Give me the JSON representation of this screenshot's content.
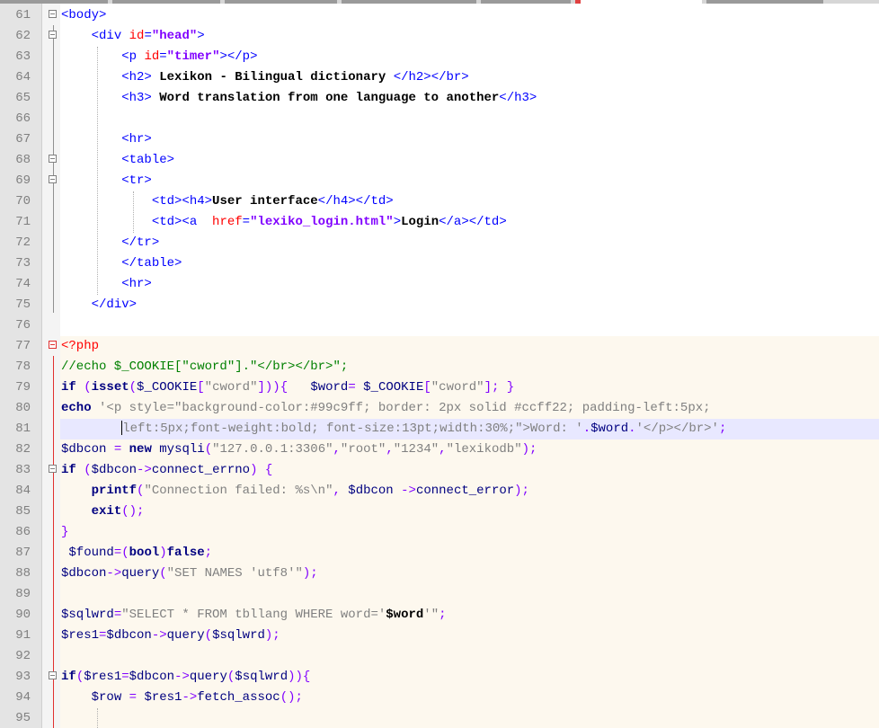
{
  "editor": {
    "lines": [
      {
        "num": "61",
        "segs": [
          {
            "c": "tag",
            "t": "<body>"
          }
        ]
      },
      {
        "num": "62",
        "segs": [
          {
            "c": "",
            "t": "    "
          },
          {
            "c": "tag",
            "t": "<div "
          },
          {
            "c": "attr",
            "t": "id"
          },
          {
            "c": "tag",
            "t": "="
          },
          {
            "c": "str",
            "t": "\"head\""
          },
          {
            "c": "tag",
            "t": ">"
          }
        ]
      },
      {
        "num": "63",
        "segs": [
          {
            "c": "",
            "t": "        "
          },
          {
            "c": "tag",
            "t": "<p "
          },
          {
            "c": "attr",
            "t": "id"
          },
          {
            "c": "tag",
            "t": "="
          },
          {
            "c": "str",
            "t": "\"timer\""
          },
          {
            "c": "tag",
            "t": "></p>"
          }
        ]
      },
      {
        "num": "64",
        "segs": [
          {
            "c": "",
            "t": "        "
          },
          {
            "c": "tag",
            "t": "<h2> "
          },
          {
            "c": "b",
            "t": "Lexikon - Bilingual dictionary "
          },
          {
            "c": "tag",
            "t": "</h2></br>"
          }
        ]
      },
      {
        "num": "65",
        "segs": [
          {
            "c": "",
            "t": "        "
          },
          {
            "c": "tag",
            "t": "<h3> "
          },
          {
            "c": "b",
            "t": "Word translation from one language to another"
          },
          {
            "c": "tag",
            "t": "</h3>"
          }
        ]
      },
      {
        "num": "66",
        "segs": []
      },
      {
        "num": "67",
        "segs": [
          {
            "c": "",
            "t": "        "
          },
          {
            "c": "tag",
            "t": "<hr>"
          }
        ]
      },
      {
        "num": "68",
        "segs": [
          {
            "c": "",
            "t": "        "
          },
          {
            "c": "tag",
            "t": "<table>"
          }
        ]
      },
      {
        "num": "69",
        "segs": [
          {
            "c": "",
            "t": "        "
          },
          {
            "c": "tag",
            "t": "<tr>"
          }
        ]
      },
      {
        "num": "70",
        "segs": [
          {
            "c": "",
            "t": "            "
          },
          {
            "c": "tag",
            "t": "<td><h4>"
          },
          {
            "c": "b",
            "t": "User interface"
          },
          {
            "c": "tag",
            "t": "</h4></td>"
          }
        ]
      },
      {
        "num": "71",
        "segs": [
          {
            "c": "",
            "t": "            "
          },
          {
            "c": "tag",
            "t": "<td><a  "
          },
          {
            "c": "attr",
            "t": "href"
          },
          {
            "c": "tag",
            "t": "="
          },
          {
            "c": "str",
            "t": "\"lexiko_login.html\""
          },
          {
            "c": "tag",
            "t": ">"
          },
          {
            "c": "b",
            "t": "Login"
          },
          {
            "c": "tag",
            "t": "</a></td>"
          }
        ]
      },
      {
        "num": "72",
        "segs": [
          {
            "c": "",
            "t": "        "
          },
          {
            "c": "tag",
            "t": "</tr>"
          }
        ]
      },
      {
        "num": "73",
        "segs": [
          {
            "c": "",
            "t": "        "
          },
          {
            "c": "tag",
            "t": "</table>"
          }
        ]
      },
      {
        "num": "74",
        "segs": [
          {
            "c": "",
            "t": "        "
          },
          {
            "c": "tag",
            "t": "<hr>"
          }
        ]
      },
      {
        "num": "75",
        "segs": [
          {
            "c": "",
            "t": "    "
          },
          {
            "c": "tag",
            "t": "</div>"
          }
        ]
      },
      {
        "num": "76",
        "segs": []
      },
      {
        "num": "77",
        "segs": [
          {
            "c": "php",
            "t": "<?php"
          }
        ]
      },
      {
        "num": "78",
        "segs": [
          {
            "c": "cm",
            "t": "//echo $_COOKIE[\"cword\"].\"</br></br>\";"
          }
        ]
      },
      {
        "num": "79",
        "segs": [
          {
            "c": "kw",
            "t": "if"
          },
          {
            "c": "",
            "t": " "
          },
          {
            "c": "op",
            "t": "("
          },
          {
            "c": "kw",
            "t": "isset"
          },
          {
            "c": "op",
            "t": "("
          },
          {
            "c": "v",
            "t": "$_COOKIE"
          },
          {
            "c": "op",
            "t": "["
          },
          {
            "c": "s",
            "t": "\"cword\""
          },
          {
            "c": "op",
            "t": "])){"
          },
          {
            "c": "",
            "t": "   "
          },
          {
            "c": "v",
            "t": "$word"
          },
          {
            "c": "op",
            "t": "="
          },
          {
            "c": "",
            "t": " "
          },
          {
            "c": "v",
            "t": "$_COOKIE"
          },
          {
            "c": "op",
            "t": "["
          },
          {
            "c": "s",
            "t": "\"cword\""
          },
          {
            "c": "op",
            "t": "];"
          },
          {
            "c": "",
            "t": " "
          },
          {
            "c": "op",
            "t": "}"
          }
        ]
      },
      {
        "num": "80",
        "segs": [
          {
            "c": "kw",
            "t": "echo"
          },
          {
            "c": "",
            "t": " "
          },
          {
            "c": "s",
            "t": "'<p style=\"background-color:#99c9ff; border: 2px solid #ccff22; padding-left:5px;"
          }
        ]
      },
      {
        "num": "81",
        "segs": [
          {
            "c": "",
            "t": "        "
          },
          {
            "c": "caret",
            "t": ""
          },
          {
            "c": "s",
            "t": "left:5px;font-weight:bold; font-size:13pt;width:30%;\">Word: '"
          },
          {
            "c": "op",
            "t": "."
          },
          {
            "c": "v",
            "t": "$word"
          },
          {
            "c": "op",
            "t": "."
          },
          {
            "c": "s",
            "t": "'</p></br>'"
          },
          {
            "c": "op",
            "t": ";"
          }
        ]
      },
      {
        "num": "82",
        "segs": [
          {
            "c": "v",
            "t": "$dbcon"
          },
          {
            "c": "",
            "t": " "
          },
          {
            "c": "op",
            "t": "="
          },
          {
            "c": "",
            "t": " "
          },
          {
            "c": "kw",
            "t": "new"
          },
          {
            "c": "",
            "t": " "
          },
          {
            "c": "v",
            "t": "mysqli"
          },
          {
            "c": "op",
            "t": "("
          },
          {
            "c": "s",
            "t": "\"127.0.0.1:3306\""
          },
          {
            "c": "op",
            "t": ","
          },
          {
            "c": "s",
            "t": "\"root\""
          },
          {
            "c": "op",
            "t": ","
          },
          {
            "c": "s",
            "t": "\"1234\""
          },
          {
            "c": "op",
            "t": ","
          },
          {
            "c": "s",
            "t": "\"lexikodb\""
          },
          {
            "c": "op",
            "t": ");"
          }
        ]
      },
      {
        "num": "83",
        "segs": [
          {
            "c": "kw",
            "t": "if"
          },
          {
            "c": "",
            "t": " "
          },
          {
            "c": "op",
            "t": "("
          },
          {
            "c": "v",
            "t": "$dbcon"
          },
          {
            "c": "op",
            "t": "->"
          },
          {
            "c": "v",
            "t": "connect_errno"
          },
          {
            "c": "op",
            "t": ")"
          },
          {
            "c": "",
            "t": " "
          },
          {
            "c": "op",
            "t": "{"
          }
        ]
      },
      {
        "num": "84",
        "segs": [
          {
            "c": "",
            "t": "    "
          },
          {
            "c": "kw",
            "t": "printf"
          },
          {
            "c": "op",
            "t": "("
          },
          {
            "c": "s",
            "t": "\"Connection failed: %s\\n\""
          },
          {
            "c": "op",
            "t": ","
          },
          {
            "c": "",
            "t": " "
          },
          {
            "c": "v",
            "t": "$dbcon"
          },
          {
            "c": "",
            "t": " "
          },
          {
            "c": "op",
            "t": "->"
          },
          {
            "c": "v",
            "t": "connect_error"
          },
          {
            "c": "op",
            "t": ");"
          }
        ]
      },
      {
        "num": "85",
        "segs": [
          {
            "c": "",
            "t": "    "
          },
          {
            "c": "kw",
            "t": "exit"
          },
          {
            "c": "op",
            "t": "();"
          }
        ]
      },
      {
        "num": "86",
        "segs": [
          {
            "c": "op",
            "t": "}"
          }
        ]
      },
      {
        "num": "87",
        "segs": [
          {
            "c": "",
            "t": " "
          },
          {
            "c": "v",
            "t": "$found"
          },
          {
            "c": "op",
            "t": "=("
          },
          {
            "c": "kw",
            "t": "bool"
          },
          {
            "c": "op",
            "t": ")"
          },
          {
            "c": "kw",
            "t": "false"
          },
          {
            "c": "op",
            "t": ";"
          }
        ]
      },
      {
        "num": "88",
        "segs": [
          {
            "c": "v",
            "t": "$dbcon"
          },
          {
            "c": "op",
            "t": "->"
          },
          {
            "c": "v",
            "t": "query"
          },
          {
            "c": "op",
            "t": "("
          },
          {
            "c": "s",
            "t": "\"SET NAMES 'utf8'\""
          },
          {
            "c": "op",
            "t": ");"
          }
        ]
      },
      {
        "num": "89",
        "segs": []
      },
      {
        "num": "90",
        "segs": [
          {
            "c": "v",
            "t": "$sqlwrd"
          },
          {
            "c": "op",
            "t": "="
          },
          {
            "c": "s",
            "t": "\"SELECT * FROM tbllang WHERE word='"
          },
          {
            "c": "b",
            "t": "$word"
          },
          {
            "c": "s",
            "t": "'\""
          },
          {
            "c": "op",
            "t": ";"
          }
        ]
      },
      {
        "num": "91",
        "segs": [
          {
            "c": "v",
            "t": "$res1"
          },
          {
            "c": "op",
            "t": "="
          },
          {
            "c": "v",
            "t": "$dbcon"
          },
          {
            "c": "op",
            "t": "->"
          },
          {
            "c": "v",
            "t": "query"
          },
          {
            "c": "op",
            "t": "("
          },
          {
            "c": "v",
            "t": "$sqlwrd"
          },
          {
            "c": "op",
            "t": ");"
          }
        ]
      },
      {
        "num": "92",
        "segs": []
      },
      {
        "num": "93",
        "segs": [
          {
            "c": "kw",
            "t": "if"
          },
          {
            "c": "op",
            "t": "("
          },
          {
            "c": "v",
            "t": "$res1"
          },
          {
            "c": "op",
            "t": "="
          },
          {
            "c": "v",
            "t": "$dbcon"
          },
          {
            "c": "op",
            "t": "->"
          },
          {
            "c": "v",
            "t": "query"
          },
          {
            "c": "op",
            "t": "("
          },
          {
            "c": "v",
            "t": "$sqlwrd"
          },
          {
            "c": "op",
            "t": ")){"
          }
        ]
      },
      {
        "num": "94",
        "segs": [
          {
            "c": "",
            "t": "    "
          },
          {
            "c": "v",
            "t": "$row"
          },
          {
            "c": "",
            "t": " "
          },
          {
            "c": "op",
            "t": "="
          },
          {
            "c": "",
            "t": " "
          },
          {
            "c": "v",
            "t": "$res1"
          },
          {
            "c": "op",
            "t": "->"
          },
          {
            "c": "v",
            "t": "fetch_assoc"
          },
          {
            "c": "op",
            "t": "();"
          }
        ]
      },
      {
        "num": "95",
        "segs": []
      }
    ],
    "fold_markers": [
      "61",
      "62",
      "68",
      "69",
      "77",
      "83",
      "93"
    ],
    "php_start": "77"
  }
}
